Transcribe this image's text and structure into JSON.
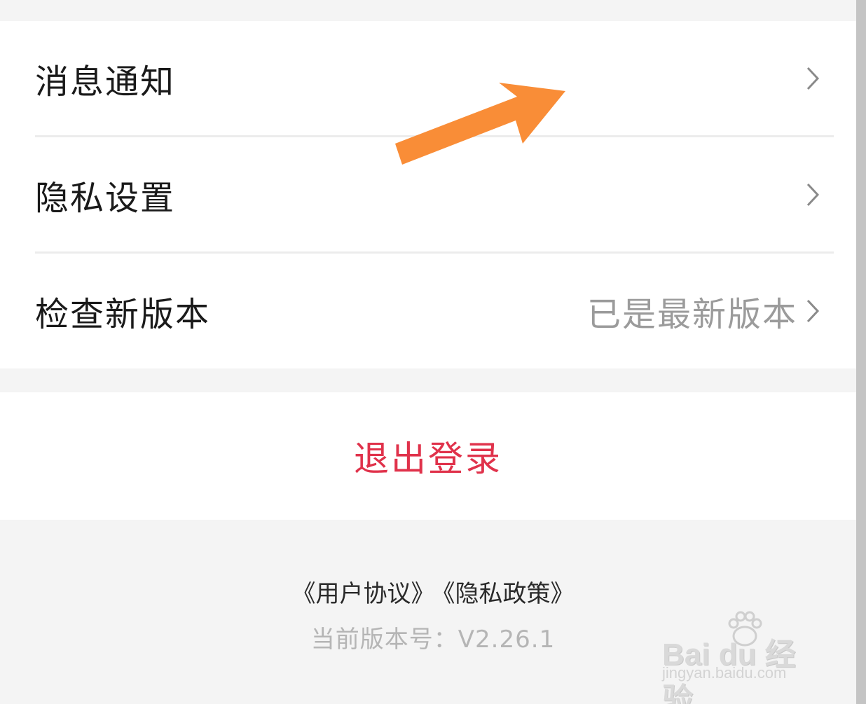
{
  "settings": {
    "items": [
      {
        "label": "消息通知",
        "value": ""
      },
      {
        "label": "隐私设置",
        "value": ""
      },
      {
        "label": "检查新版本",
        "value": "已是最新版本"
      }
    ]
  },
  "logout": {
    "label": "退出登录"
  },
  "footer": {
    "user_agreement": "《用户协议》",
    "privacy_policy": "《隐私政策》",
    "version": "当前版本号：V2.26.1"
  },
  "watermark": {
    "brand": "Bai  du 经验",
    "url": "jingyan.baidu.com"
  },
  "colors": {
    "logout": "#e0324b",
    "arrow": "#f98d37",
    "page_bg": "#f4f4f4"
  },
  "icons": [
    "chevron-right-icon",
    "annotation-arrow-icon",
    "baidu-paw-icon"
  ]
}
